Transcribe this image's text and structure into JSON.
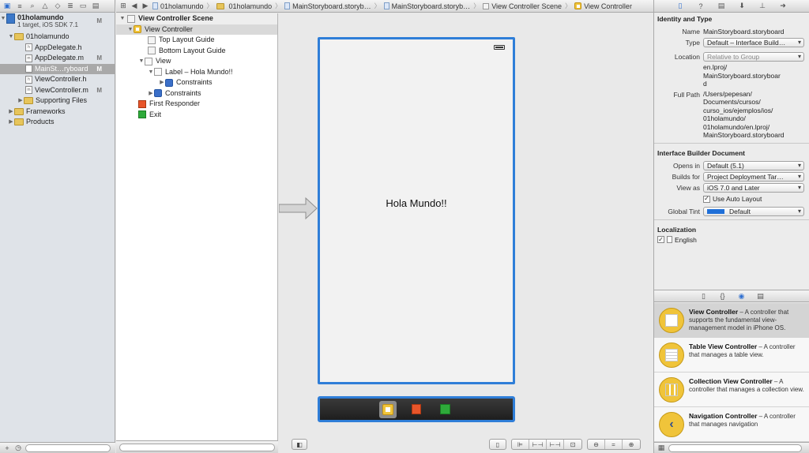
{
  "navigator": {
    "project": {
      "name": "01holamundo",
      "subtitle": "1 target, iOS SDK 7.1",
      "badge": "M"
    },
    "group": {
      "name": "01holamundo"
    },
    "files": [
      {
        "name": "AppDelegate.h",
        "badge": ""
      },
      {
        "name": "AppDelegate.m",
        "badge": "M"
      },
      {
        "name": "MainSt…ryboard",
        "badge": "M"
      },
      {
        "name": "ViewController.h",
        "badge": ""
      },
      {
        "name": "ViewController.m",
        "badge": "M"
      }
    ],
    "folders": [
      {
        "name": "Supporting Files"
      },
      {
        "name": "Frameworks"
      },
      {
        "name": "Products"
      }
    ]
  },
  "jumpbar": {
    "crumbs": [
      "01holamundo",
      "01holamundo",
      "MainStoryboard.storyb…",
      "MainStoryboard.storyb…",
      "View Controller Scene",
      "View Controller"
    ]
  },
  "outline": {
    "scene": "View Controller Scene",
    "view_controller": "View Controller",
    "top_layout_guide": "Top Layout Guide",
    "bottom_layout_guide": "Bottom Layout Guide",
    "view": "View",
    "label": "Label – Hola Mundo!!",
    "label_constraints": "Constraints",
    "view_constraints": "Constraints",
    "first_responder": "First Responder",
    "exit": "Exit"
  },
  "canvas": {
    "label_text": "Hola Mundo!!"
  },
  "inspector": {
    "identity_title": "Identity and Type",
    "name_label": "Name",
    "name_value": "MainStoryboard.storyboard",
    "type_label": "Type",
    "type_value": "Default – Interface Build…",
    "location_label": "Location",
    "location_value": "Relative to Group",
    "location_path": "en.lproj/\nMainStoryboard.storyboar\nd",
    "fullpath_label": "Full Path",
    "fullpath_value": "/Users/pepesan/\nDocuments/cursos/\ncurso_ios/ejemplos/ios/\n01holamundo/\n01holamundo/en.lproj/\nMainStoryboard.storyboard",
    "ibdoc_title": "Interface Builder Document",
    "opens_in_label": "Opens in",
    "opens_in_value": "Default (5.1)",
    "builds_for_label": "Builds for",
    "builds_for_value": "Project Deployment Tar…",
    "view_as_label": "View as",
    "view_as_value": "iOS 7.0 and Later",
    "autolayout_label": "Use Auto Layout",
    "global_tint_label": "Global Tint",
    "global_tint_value": "Default",
    "global_tint_color": "#1f6fd8",
    "localization_title": "Localization",
    "localization_item": "English"
  },
  "library": [
    {
      "title": "View Controller",
      "desc": " – A controller that supports the fundamental view-management model in iPhone OS."
    },
    {
      "title": "Table View Controller",
      "desc": " – A controller that manages a table view."
    },
    {
      "title": "Collection View Controller",
      "desc": " – A controller that manages a collection view."
    },
    {
      "title": "Navigation Controller",
      "desc": " – A controller that manages navigation"
    }
  ],
  "colors": {
    "selection_blue": "#2f7ed8",
    "vc_yellow": "#f0c43a",
    "responder_orange": "#e8552a",
    "exit_green": "#2eaa3a"
  }
}
